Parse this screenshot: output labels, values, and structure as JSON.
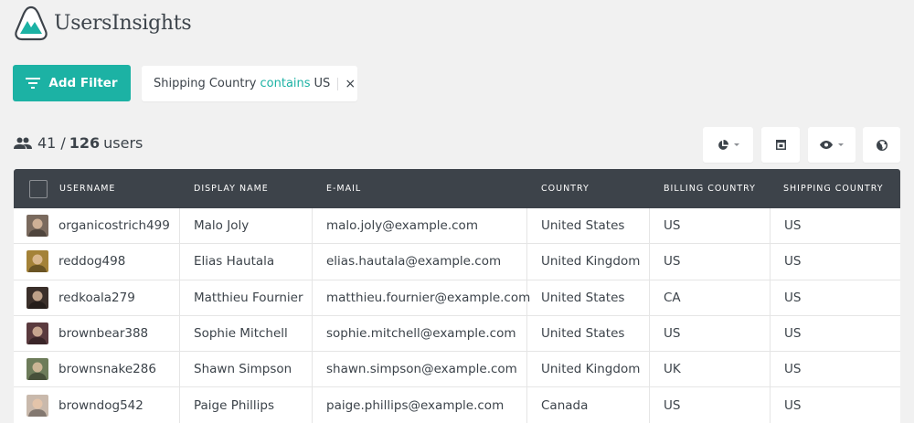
{
  "brand": {
    "name": "UsersInsights",
    "color": "#1cb2a4"
  },
  "toolbar": {
    "add_filter_label": "Add Filter"
  },
  "filter": {
    "field": "Shipping Country",
    "operator": "contains",
    "value": "US",
    "remove_symbol": "×"
  },
  "counts": {
    "filtered": "41",
    "separator": "/",
    "total": "126",
    "unit": "users"
  },
  "header_icons": [
    "segments-pie-icon",
    "columns-icon",
    "visibility-eye-icon",
    "map-globe-icon"
  ],
  "table": {
    "columns": [
      "USERNAME",
      "DISPLAY NAME",
      "E-MAIL",
      "COUNTRY",
      "BILLING COUNTRY",
      "SHIPPING COUNTRY"
    ],
    "rows": [
      {
        "username": "organicostrich499",
        "display_name": "Malo Joly",
        "email": "malo.joly@example.com",
        "country": "United States",
        "billing": "US",
        "shipping": "US",
        "avatar_color": "#7a6a5e"
      },
      {
        "username": "reddog498",
        "display_name": "Elias Hautala",
        "email": "elias.hautala@example.com",
        "country": "United Kingdom",
        "billing": "US",
        "shipping": "US",
        "avatar_color": "#a48238"
      },
      {
        "username": "redkoala279",
        "display_name": "Matthieu Fournier",
        "email": "matthieu.fournier@example.com",
        "country": "United States",
        "billing": "CA",
        "shipping": "US",
        "avatar_color": "#3a2f2a"
      },
      {
        "username": "brownbear388",
        "display_name": "Sophie Mitchell",
        "email": "sophie.mitchell@example.com",
        "country": "United States",
        "billing": "US",
        "shipping": "US",
        "avatar_color": "#5a3a3e"
      },
      {
        "username": "brownsnake286",
        "display_name": "Shawn Simpson",
        "email": "shawn.simpson@example.com",
        "country": "United Kingdom",
        "billing": "UK",
        "shipping": "US",
        "avatar_color": "#6d7c5a"
      },
      {
        "username": "browndog542",
        "display_name": "Paige Phillips",
        "email": "paige.phillips@example.com",
        "country": "Canada",
        "billing": "US",
        "shipping": "US",
        "avatar_color": "#c9b9ac"
      }
    ]
  }
}
